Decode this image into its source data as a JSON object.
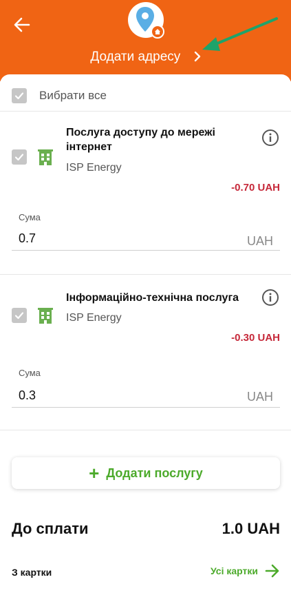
{
  "header": {
    "add_address_label": "Додати адресу",
    "brand_color": "#f06414"
  },
  "select_all": {
    "label": "Вибрати все",
    "checked": true
  },
  "services": [
    {
      "title": "Послуга доступу до мережі інтернет",
      "provider": "ISP Energy",
      "amount": "-0.70 UAH",
      "sum_label": "Сума",
      "sum_value": "0.7",
      "unit": "UAH",
      "checked": true
    },
    {
      "title": "Інформаційно-технічна послуга",
      "provider": "ISP Energy",
      "amount": "-0.30 UAH",
      "sum_label": "Сума",
      "sum_value": "0.3",
      "unit": "UAH",
      "checked": true
    }
  ],
  "add_service": {
    "label": "Додати послугу"
  },
  "total": {
    "label": "До сплати",
    "value": "1.0 UAH"
  },
  "payment": {
    "from_card_label": "З картки",
    "all_cards_label": "Усі картки"
  },
  "colors": {
    "accent_green": "#4caa2b",
    "negative_red": "#c62839",
    "annotation_arrow": "#1fa36a"
  }
}
